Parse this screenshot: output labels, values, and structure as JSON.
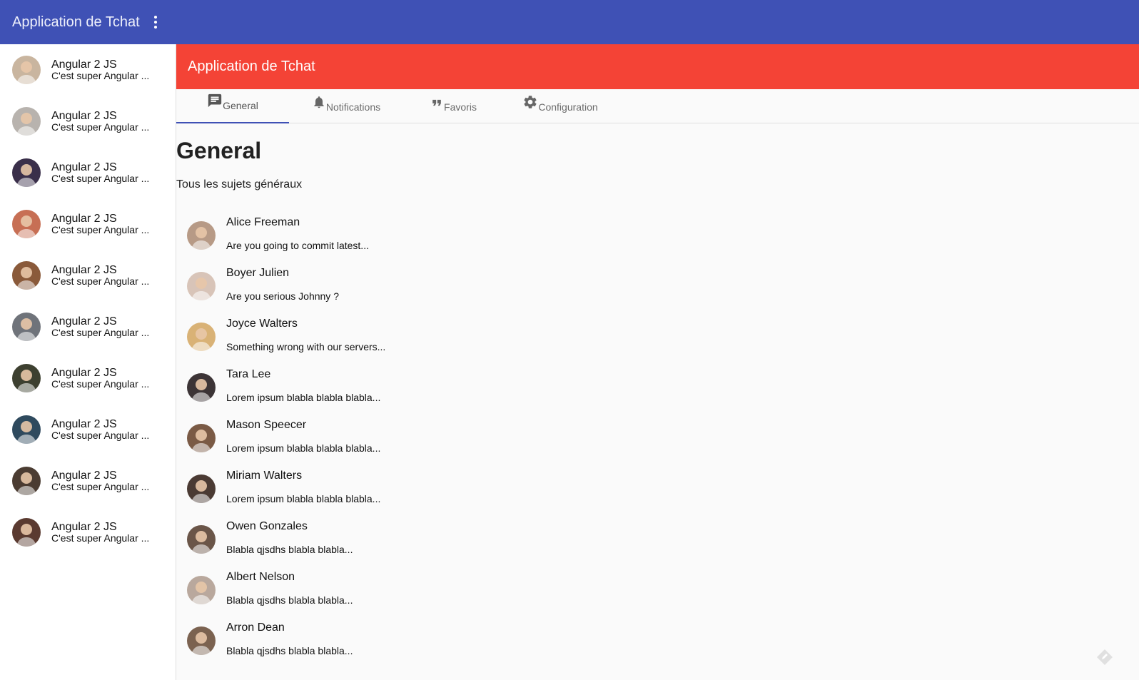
{
  "header": {
    "title": "Application de Tchat",
    "menu_icon": "more-vert-icon"
  },
  "sidebar": {
    "items": [
      {
        "title": "Angular 2 JS",
        "subtitle": "C'est super Angular ...",
        "avatar_color": "#c9b59f"
      },
      {
        "title": "Angular 2 JS",
        "subtitle": "C'est super Angular ...",
        "avatar_color": "#b8b3ae"
      },
      {
        "title": "Angular 2 JS",
        "subtitle": "C'est super Angular ...",
        "avatar_color": "#3a2f4a"
      },
      {
        "title": "Angular 2 JS",
        "subtitle": "C'est super Angular ...",
        "avatar_color": "#c76f54"
      },
      {
        "title": "Angular 2 JS",
        "subtitle": "C'est super Angular ...",
        "avatar_color": "#8a5a3a"
      },
      {
        "title": "Angular 2 JS",
        "subtitle": "C'est super Angular ...",
        "avatar_color": "#6f737a"
      },
      {
        "title": "Angular 2 JS",
        "subtitle": "C'est super Angular ...",
        "avatar_color": "#3d4030"
      },
      {
        "title": "Angular 2 JS",
        "subtitle": "C'est super Angular ...",
        "avatar_color": "#2f4a5e"
      },
      {
        "title": "Angular 2 JS",
        "subtitle": "C'est super Angular ...",
        "avatar_color": "#4b3c32"
      },
      {
        "title": "Angular 2 JS",
        "subtitle": "C'est super Angular ...",
        "avatar_color": "#5a3a30"
      }
    ]
  },
  "panel": {
    "title": "Application de Tchat",
    "accent": "#f44336"
  },
  "tabs": [
    {
      "label": "General",
      "icon": "chat-icon",
      "active": true
    },
    {
      "label": "Notifications",
      "icon": "bell-icon",
      "active": false
    },
    {
      "label": "Favoris",
      "icon": "quote-icon",
      "active": false
    },
    {
      "label": "Configuration",
      "icon": "gear-icon",
      "active": false
    }
  ],
  "content": {
    "heading": "General",
    "description": "Tous les sujets généraux",
    "messages": [
      {
        "name": "Alice Freeman",
        "text": "Are you going to commit latest...",
        "avatar_color": "#b79a86"
      },
      {
        "name": "Boyer Julien",
        "text": "Are you serious Johnny ?",
        "avatar_color": "#d8c4b8"
      },
      {
        "name": "Joyce Walters",
        "text": "Something wrong with our servers...",
        "avatar_color": "#d9b276"
      },
      {
        "name": "Tara Lee",
        "text": "Lorem ipsum blabla blabla blabla...",
        "avatar_color": "#3c3436"
      },
      {
        "name": "Mason Speecer",
        "text": "Lorem ipsum blabla blabla blabla...",
        "avatar_color": "#7a5a45"
      },
      {
        "name": "Miriam Walters",
        "text": "Lorem ipsum blabla blabla blabla...",
        "avatar_color": "#4a3a33"
      },
      {
        "name": "Owen Gonzales",
        "text": "Blabla qjsdhs blabla blabla...",
        "avatar_color": "#6a5548"
      },
      {
        "name": "Albert Nelson",
        "text": "Blabla qjsdhs blabla blabla...",
        "avatar_color": "#b9a89d"
      },
      {
        "name": "Arron Dean",
        "text": "Blabla qjsdhs blabla blabla...",
        "avatar_color": "#7b6250"
      }
    ]
  },
  "colors": {
    "primary": "#3f51b5",
    "accent": "#f44336"
  }
}
